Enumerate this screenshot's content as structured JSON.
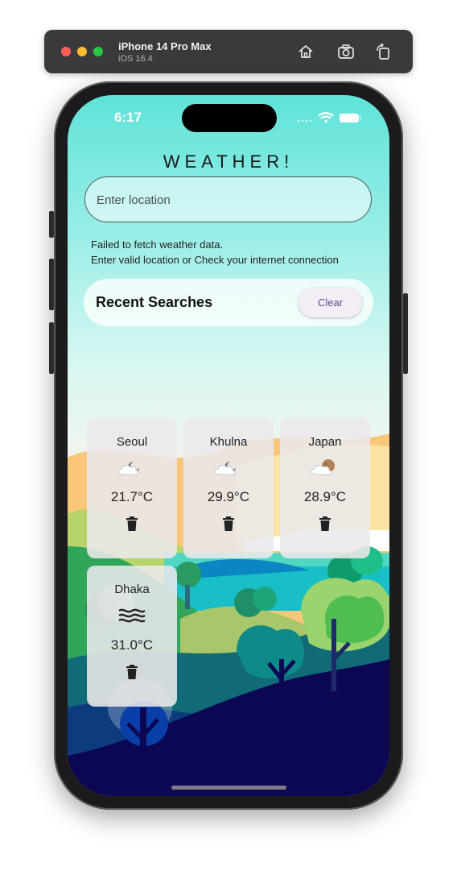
{
  "simulator": {
    "device_name": "iPhone 14 Pro Max",
    "os_version": "iOS 16.4",
    "toolbar_icons": [
      "home-icon",
      "screenshot-icon",
      "rotate-icon"
    ]
  },
  "status_bar": {
    "time": "6:17"
  },
  "app": {
    "title": "WEATHER!",
    "search": {
      "placeholder": "Enter location",
      "value": ""
    },
    "error_line1": "Failed to fetch weather data.",
    "error_line2": "Enter valid location or Check your internet connection",
    "recent": {
      "title": "Recent Searches",
      "clear_label": "Clear"
    },
    "cards": [
      {
        "city": "Seoul",
        "temp": "21.7°C",
        "icon": "cloudy-night-icon"
      },
      {
        "city": "Khulna",
        "temp": "29.9°C",
        "icon": "cloudy-night-icon"
      },
      {
        "city": "Japan",
        "temp": "28.9°C",
        "icon": "moon-cloud-icon"
      },
      {
        "city": "Dhaka",
        "temp": "31.0°C",
        "icon": "haze-icon"
      }
    ]
  },
  "colors": {
    "accent": "#5b4a8a",
    "sky_top": "#5fe3d8",
    "ground_dark": "#0b0752"
  }
}
